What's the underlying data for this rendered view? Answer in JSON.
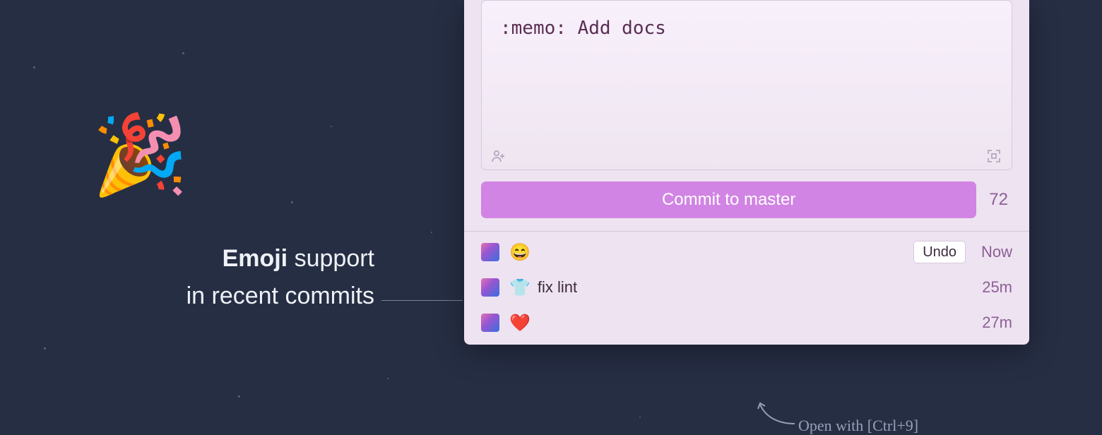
{
  "hero": {
    "emoji": "🎉",
    "caption_bold": "Emoji",
    "caption_rest_line1": " support",
    "caption_line2": "in recent commits"
  },
  "input": {
    "value": ":memo: Add docs"
  },
  "commit_button": {
    "label": "Commit to master",
    "char_count": "72"
  },
  "undo_label": "Undo",
  "commits": [
    {
      "emoji": "😄",
      "text": "",
      "time": "Now",
      "undo": true
    },
    {
      "emoji": "👕",
      "text": "fix lint",
      "time": "25m",
      "undo": false
    },
    {
      "emoji": "❤️",
      "text": "",
      "time": "27m",
      "undo": false
    }
  ],
  "hint": "Open with [Ctrl+9]"
}
